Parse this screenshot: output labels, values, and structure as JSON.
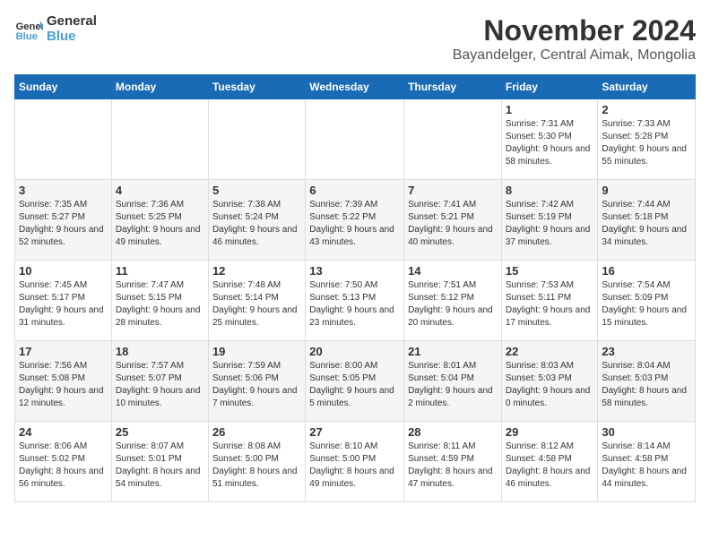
{
  "logo": {
    "text_general": "General",
    "text_blue": "Blue"
  },
  "header": {
    "month": "November 2024",
    "location": "Bayandelger, Central Aimak, Mongolia"
  },
  "weekdays": [
    "Sunday",
    "Monday",
    "Tuesday",
    "Wednesday",
    "Thursday",
    "Friday",
    "Saturday"
  ],
  "weeks": [
    [
      {
        "day": "",
        "info": ""
      },
      {
        "day": "",
        "info": ""
      },
      {
        "day": "",
        "info": ""
      },
      {
        "day": "",
        "info": ""
      },
      {
        "day": "",
        "info": ""
      },
      {
        "day": "1",
        "info": "Sunrise: 7:31 AM\nSunset: 5:30 PM\nDaylight: 9 hours and 58 minutes."
      },
      {
        "day": "2",
        "info": "Sunrise: 7:33 AM\nSunset: 5:28 PM\nDaylight: 9 hours and 55 minutes."
      }
    ],
    [
      {
        "day": "3",
        "info": "Sunrise: 7:35 AM\nSunset: 5:27 PM\nDaylight: 9 hours and 52 minutes."
      },
      {
        "day": "4",
        "info": "Sunrise: 7:36 AM\nSunset: 5:25 PM\nDaylight: 9 hours and 49 minutes."
      },
      {
        "day": "5",
        "info": "Sunrise: 7:38 AM\nSunset: 5:24 PM\nDaylight: 9 hours and 46 minutes."
      },
      {
        "day": "6",
        "info": "Sunrise: 7:39 AM\nSunset: 5:22 PM\nDaylight: 9 hours and 43 minutes."
      },
      {
        "day": "7",
        "info": "Sunrise: 7:41 AM\nSunset: 5:21 PM\nDaylight: 9 hours and 40 minutes."
      },
      {
        "day": "8",
        "info": "Sunrise: 7:42 AM\nSunset: 5:19 PM\nDaylight: 9 hours and 37 minutes."
      },
      {
        "day": "9",
        "info": "Sunrise: 7:44 AM\nSunset: 5:18 PM\nDaylight: 9 hours and 34 minutes."
      }
    ],
    [
      {
        "day": "10",
        "info": "Sunrise: 7:45 AM\nSunset: 5:17 PM\nDaylight: 9 hours and 31 minutes."
      },
      {
        "day": "11",
        "info": "Sunrise: 7:47 AM\nSunset: 5:15 PM\nDaylight: 9 hours and 28 minutes."
      },
      {
        "day": "12",
        "info": "Sunrise: 7:48 AM\nSunset: 5:14 PM\nDaylight: 9 hours and 25 minutes."
      },
      {
        "day": "13",
        "info": "Sunrise: 7:50 AM\nSunset: 5:13 PM\nDaylight: 9 hours and 23 minutes."
      },
      {
        "day": "14",
        "info": "Sunrise: 7:51 AM\nSunset: 5:12 PM\nDaylight: 9 hours and 20 minutes."
      },
      {
        "day": "15",
        "info": "Sunrise: 7:53 AM\nSunset: 5:11 PM\nDaylight: 9 hours and 17 minutes."
      },
      {
        "day": "16",
        "info": "Sunrise: 7:54 AM\nSunset: 5:09 PM\nDaylight: 9 hours and 15 minutes."
      }
    ],
    [
      {
        "day": "17",
        "info": "Sunrise: 7:56 AM\nSunset: 5:08 PM\nDaylight: 9 hours and 12 minutes."
      },
      {
        "day": "18",
        "info": "Sunrise: 7:57 AM\nSunset: 5:07 PM\nDaylight: 9 hours and 10 minutes."
      },
      {
        "day": "19",
        "info": "Sunrise: 7:59 AM\nSunset: 5:06 PM\nDaylight: 9 hours and 7 minutes."
      },
      {
        "day": "20",
        "info": "Sunrise: 8:00 AM\nSunset: 5:05 PM\nDaylight: 9 hours and 5 minutes."
      },
      {
        "day": "21",
        "info": "Sunrise: 8:01 AM\nSunset: 5:04 PM\nDaylight: 9 hours and 2 minutes."
      },
      {
        "day": "22",
        "info": "Sunrise: 8:03 AM\nSunset: 5:03 PM\nDaylight: 9 hours and 0 minutes."
      },
      {
        "day": "23",
        "info": "Sunrise: 8:04 AM\nSunset: 5:03 PM\nDaylight: 8 hours and 58 minutes."
      }
    ],
    [
      {
        "day": "24",
        "info": "Sunrise: 8:06 AM\nSunset: 5:02 PM\nDaylight: 8 hours and 56 minutes."
      },
      {
        "day": "25",
        "info": "Sunrise: 8:07 AM\nSunset: 5:01 PM\nDaylight: 8 hours and 54 minutes."
      },
      {
        "day": "26",
        "info": "Sunrise: 8:08 AM\nSunset: 5:00 PM\nDaylight: 8 hours and 51 minutes."
      },
      {
        "day": "27",
        "info": "Sunrise: 8:10 AM\nSunset: 5:00 PM\nDaylight: 8 hours and 49 minutes."
      },
      {
        "day": "28",
        "info": "Sunrise: 8:11 AM\nSunset: 4:59 PM\nDaylight: 8 hours and 47 minutes."
      },
      {
        "day": "29",
        "info": "Sunrise: 8:12 AM\nSunset: 4:58 PM\nDaylight: 8 hours and 46 minutes."
      },
      {
        "day": "30",
        "info": "Sunrise: 8:14 AM\nSunset: 4:58 PM\nDaylight: 8 hours and 44 minutes."
      }
    ]
  ]
}
